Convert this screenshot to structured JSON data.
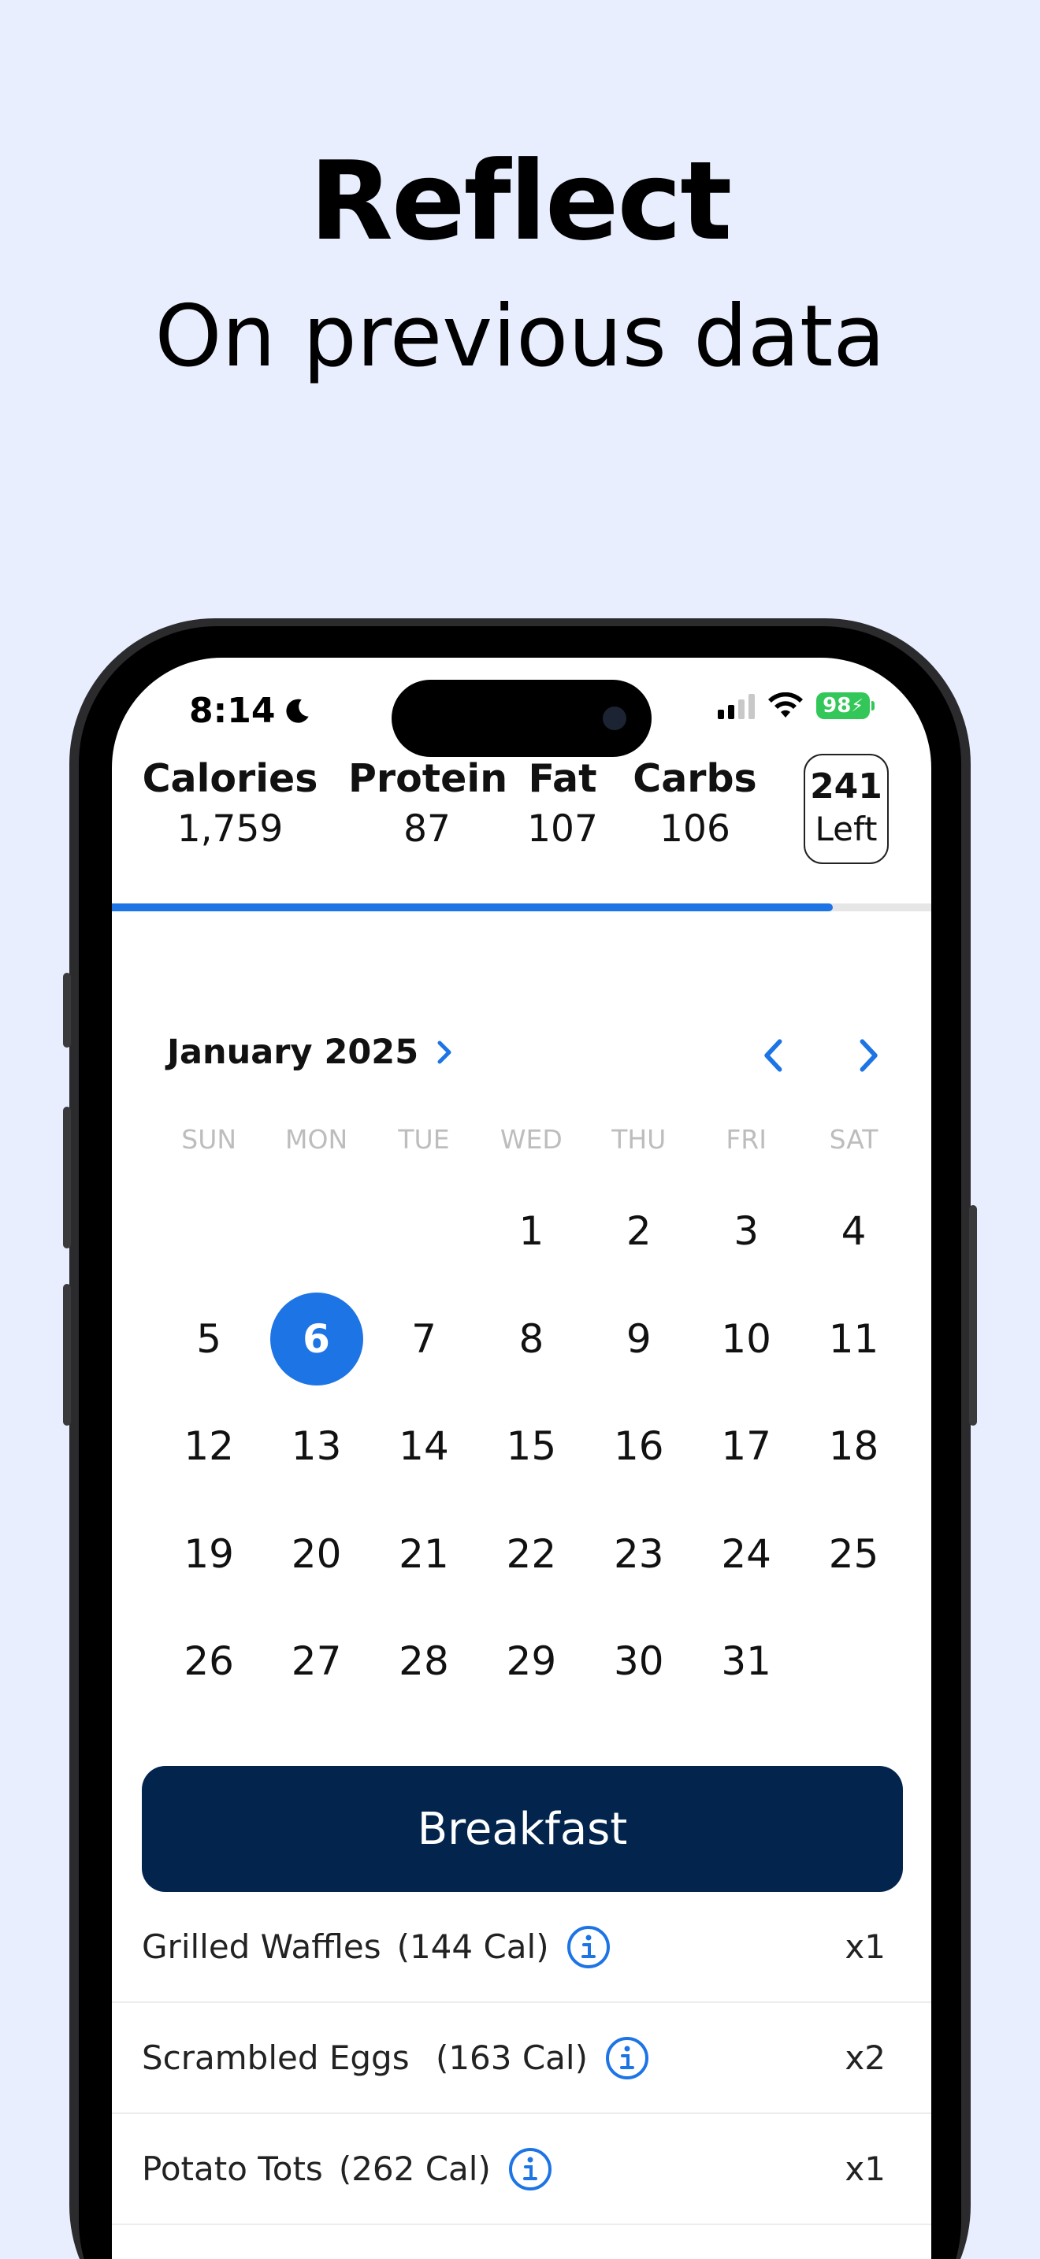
{
  "hero": {
    "title": "Reflect",
    "subtitle": "On previous data"
  },
  "status_bar": {
    "time": "8:14",
    "battery": "98"
  },
  "macros": [
    {
      "label": "Calories",
      "value": "1,759"
    },
    {
      "label": "Protein",
      "value": "87"
    },
    {
      "label": "Fat",
      "value": "107"
    },
    {
      "label": "Carbs",
      "value": "106"
    }
  ],
  "remaining": {
    "value": "241",
    "label": "Left"
  },
  "progress": {
    "fraction": 0.88,
    "color": "#1d74e5"
  },
  "calendar": {
    "month": "January 2025",
    "weekdays": [
      "SUN",
      "MON",
      "TUE",
      "WED",
      "THU",
      "FRI",
      "SAT"
    ],
    "selected_day": "6",
    "weeks": [
      [
        "",
        "",
        "",
        "1",
        "2",
        "3",
        "4"
      ],
      [
        "5",
        "6",
        "7",
        "8",
        "9",
        "10",
        "11"
      ],
      [
        "12",
        "13",
        "14",
        "15",
        "16",
        "17",
        "18"
      ],
      [
        "19",
        "20",
        "21",
        "22",
        "23",
        "24",
        "25"
      ],
      [
        "26",
        "27",
        "28",
        "29",
        "30",
        "31",
        ""
      ]
    ]
  },
  "meal": {
    "title": "Breakfast",
    "items": [
      {
        "name": "Grilled Waffles",
        "calories": "(144 Cal)",
        "qty": "x1"
      },
      {
        "name": "Scrambled Eggs ",
        "calories": "(163 Cal)",
        "qty": "x2"
      },
      {
        "name": "Potato Tots",
        "calories": "(262 Cal)",
        "qty": "x1"
      }
    ]
  },
  "colors": {
    "accent": "#1d74e5",
    "meal_header": "#02244d",
    "background": "#e8eefd",
    "battery": "#33c759"
  }
}
